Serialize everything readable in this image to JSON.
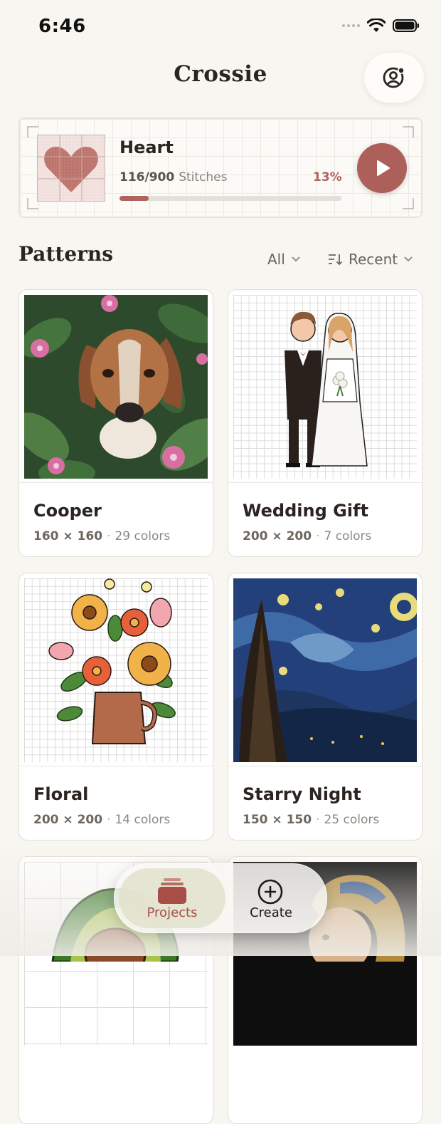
{
  "status_bar": {
    "time": "6:46"
  },
  "header": {
    "title": "Crossie"
  },
  "current_project": {
    "name": "Heart",
    "progress_count": "116/900",
    "progress_unit": "Stitches",
    "progress_percent_label": "13%",
    "progress_fraction": 0.13
  },
  "patterns": {
    "section_title": "Patterns",
    "filter_label": "All",
    "sort_label": "Recent",
    "items": [
      {
        "name": "Cooper",
        "dims": "160 × 160",
        "colors": "29 colors"
      },
      {
        "name": "Wedding Gift",
        "dims": "200 × 200",
        "colors": "7 colors"
      },
      {
        "name": "Floral",
        "dims": "200 × 200",
        "colors": "14 colors"
      },
      {
        "name": "Starry Night",
        "dims": "150 × 150",
        "colors": "25 colors"
      }
    ]
  },
  "tabbar": {
    "projects_label": "Projects",
    "create_label": "Create"
  },
  "colors": {
    "accent": "#ad5f5a",
    "background": "#f8f6f0",
    "text": "#2b2420"
  }
}
